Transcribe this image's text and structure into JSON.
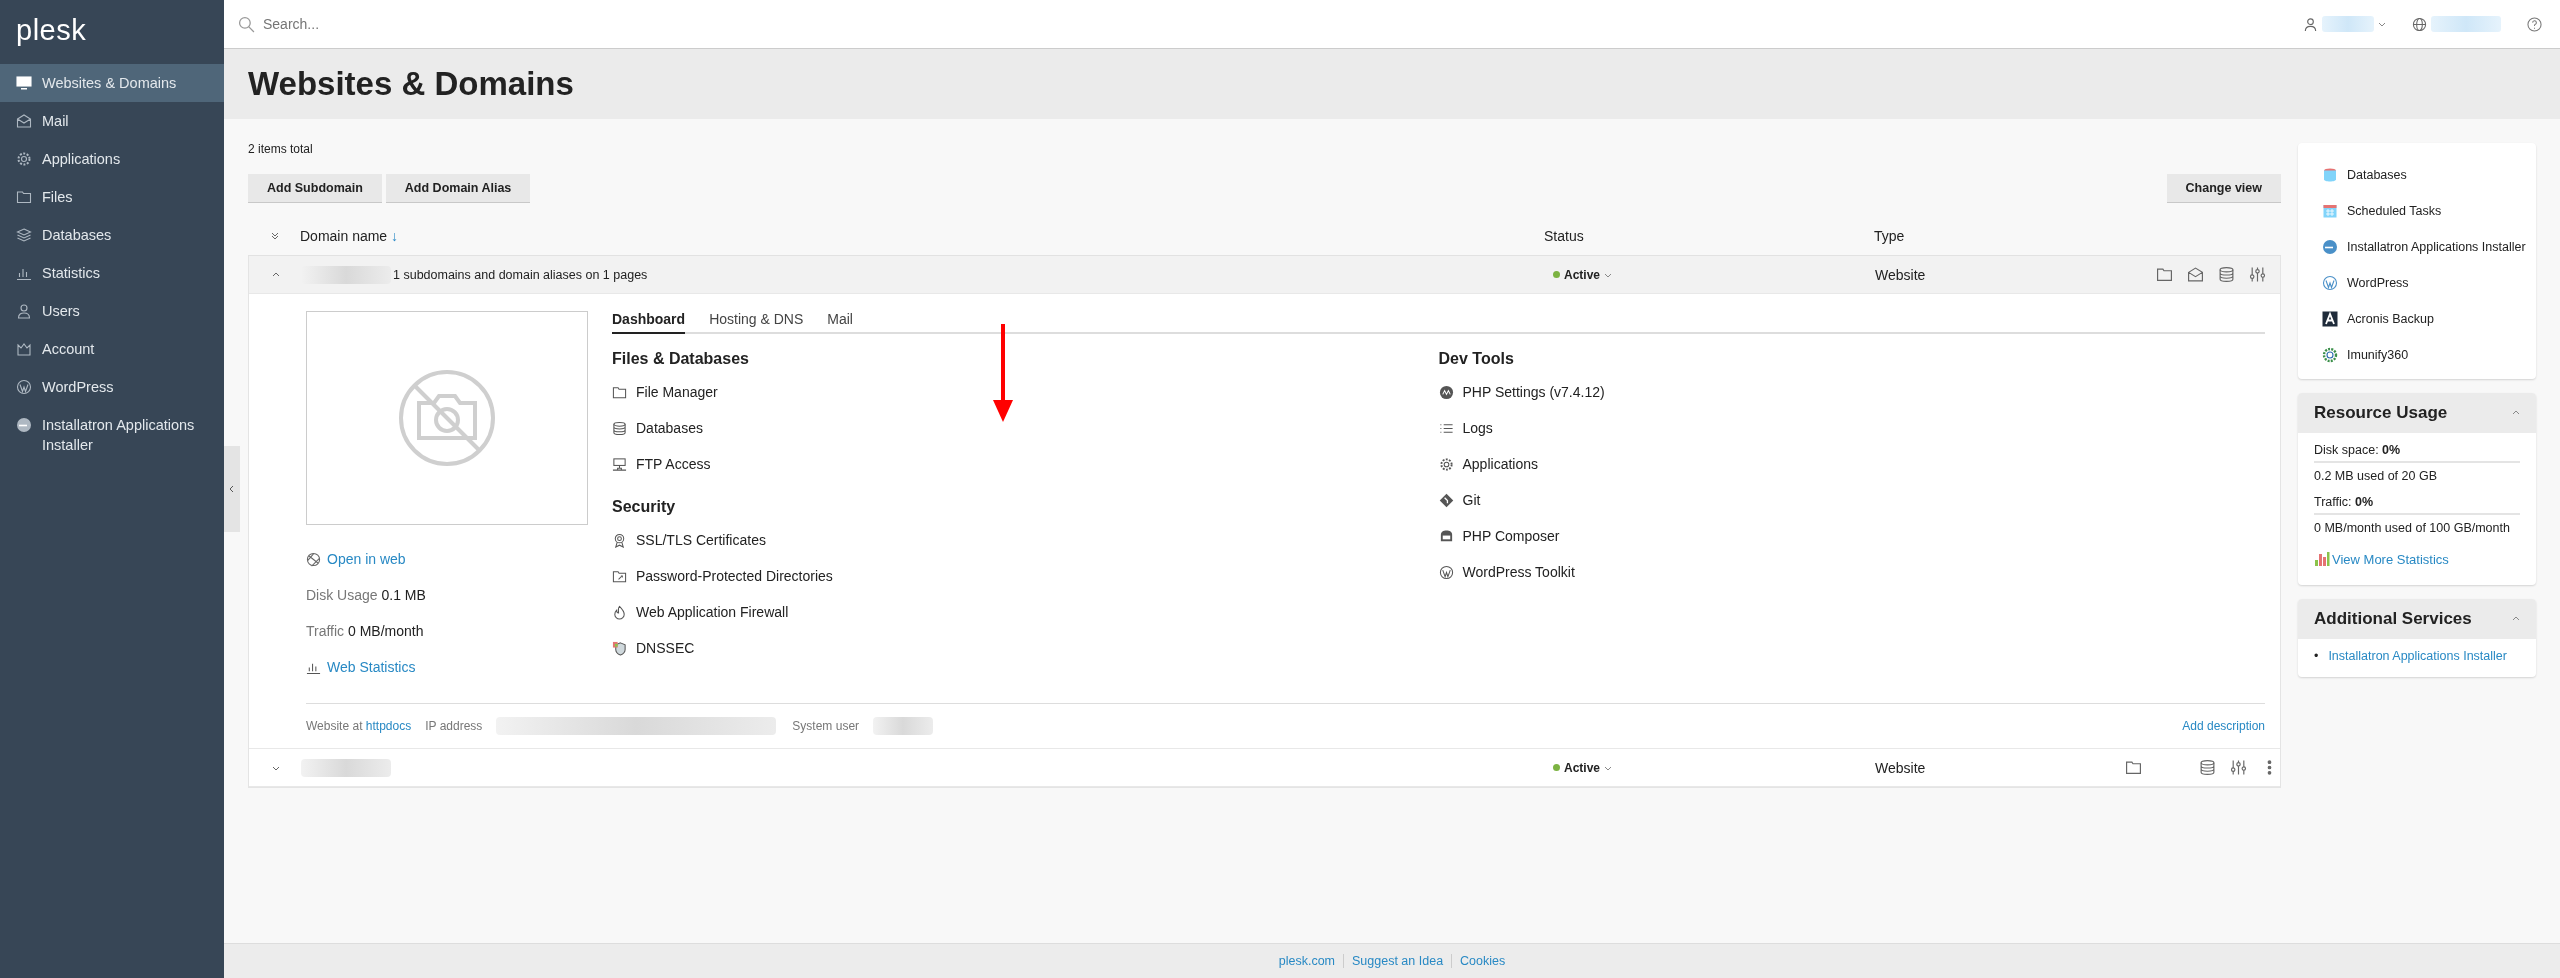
{
  "logo": "plesk",
  "sidebar": {
    "items": [
      {
        "label": "Websites & Domains",
        "selected": true
      },
      {
        "label": "Mail",
        "selected": false
      },
      {
        "label": "Applications",
        "selected": false
      },
      {
        "label": "Files",
        "selected": false
      },
      {
        "label": "Databases",
        "selected": false
      },
      {
        "label": "Statistics",
        "selected": false
      },
      {
        "label": "Users",
        "selected": false
      },
      {
        "label": "Account",
        "selected": false
      },
      {
        "label": "WordPress",
        "selected": false
      },
      {
        "label": "Installatron Applications Installer",
        "selected": false
      }
    ]
  },
  "search": {
    "placeholder": "Search..."
  },
  "page_title": "Websites & Domains",
  "items_total": "2 items total",
  "toolbar": {
    "buttons": [
      "Add Subdomain",
      "Add Domain Alias"
    ],
    "change_view": "Change view"
  },
  "table": {
    "columns": [
      "Domain name",
      "Status",
      "Type"
    ],
    "sort_mark": "↓",
    "rows": [
      {
        "expanded": true,
        "subtitle": "1 subdomains and domain aliases on 1 pages",
        "status": "Active",
        "color": "#7cb342",
        "type": "Website"
      },
      {
        "expanded": false,
        "status": "Active",
        "color": "#7cb342",
        "type": "Website"
      }
    ]
  },
  "details": {
    "open_in_web": "Open in web",
    "stats": [
      {
        "label": "Disk Usage",
        "value": "0.1 MB"
      },
      {
        "label": "Traffic",
        "value": "0 MB/month"
      }
    ],
    "web_statistics": "Web Statistics",
    "tabs": [
      {
        "label": "Dashboard",
        "selected": true
      },
      {
        "label": "Hosting & DNS",
        "selected": false
      },
      {
        "label": "Mail",
        "selected": false
      }
    ],
    "columns": [
      [
        {
          "title": "Files & Databases",
          "items": [
            "File Manager",
            "Databases",
            "FTP Access"
          ]
        },
        {
          "title": "Security",
          "items": [
            "SSL/TLS Certificates",
            "Password-Protected Directories",
            "Web Application Firewall",
            "DNSSEC"
          ]
        }
      ],
      [
        {
          "title": "Dev Tools",
          "items": [
            "PHP Settings (v7.4.12)",
            "Logs",
            "Applications",
            "Git",
            "PHP Composer",
            "WordPress Toolkit"
          ]
        }
      ]
    ],
    "footer": {
      "website_at": "Website at",
      "docroot": "httpdocs",
      "ip_label": "IP address",
      "user_label": "System user",
      "add_description": "Add description"
    }
  },
  "right": {
    "links": [
      "Databases",
      "Scheduled Tasks",
      "Installatron Applications Installer",
      "WordPress",
      "Acronis Backup",
      "Imunify360"
    ],
    "resource": {
      "title": "Resource Usage",
      "expanded": true,
      "meters": [
        {
          "label": "Disk space:",
          "pct": "0%",
          "level": 0,
          "text": "0.2 MB used of 20 GB"
        },
        {
          "label": "Traffic:",
          "pct": "0%",
          "level": 0,
          "text": "0 MB/month used of 100 GB/month"
        }
      ],
      "more": "View More Statistics"
    },
    "additional": {
      "title": "Additional Services",
      "expanded": true,
      "bullet": "•",
      "items": [
        "Installatron Applications Installer"
      ]
    }
  },
  "page_footer": [
    "plesk.com",
    "Suggest an Idea",
    "Cookies"
  ]
}
